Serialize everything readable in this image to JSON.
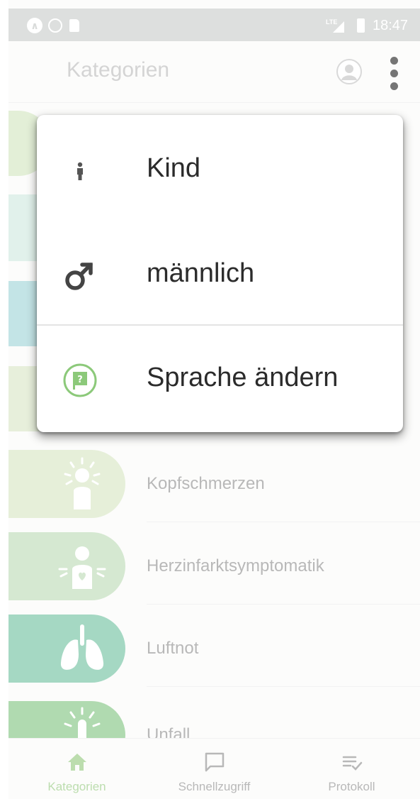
{
  "status_bar": {
    "network": "LTE",
    "time": "18:47"
  },
  "app_bar": {
    "title": "Kategorien"
  },
  "categories": [
    {
      "label": "Kopfschmerzen",
      "icon": "headache-icon",
      "color": "#dbe9c9"
    },
    {
      "label": "Herzinfarktsymptomatik",
      "icon": "heart-attack-icon",
      "color": "#c3dfbd"
    },
    {
      "label": "Luftnot",
      "icon": "lungs-icon",
      "color": "#7fc7aa"
    },
    {
      "label": "Unfall",
      "icon": "accident-icon",
      "color": "#8fca8f"
    }
  ],
  "menu": {
    "items": [
      {
        "label": "Kind",
        "icon": "child-icon"
      },
      {
        "label": "männlich",
        "icon": "male-icon"
      },
      {
        "label": "Sprache ändern",
        "icon": "language-flag-icon"
      }
    ]
  },
  "bottom_nav": {
    "items": [
      {
        "label": "Kategorien",
        "icon": "home-icon",
        "active": true
      },
      {
        "label": "Schnellzugriff",
        "icon": "chat-icon",
        "active": false
      },
      {
        "label": "Protokoll",
        "icon": "checklist-icon",
        "active": false
      }
    ],
    "active_color": "#9fcf8c",
    "inactive_color": "#9a9a9a"
  }
}
